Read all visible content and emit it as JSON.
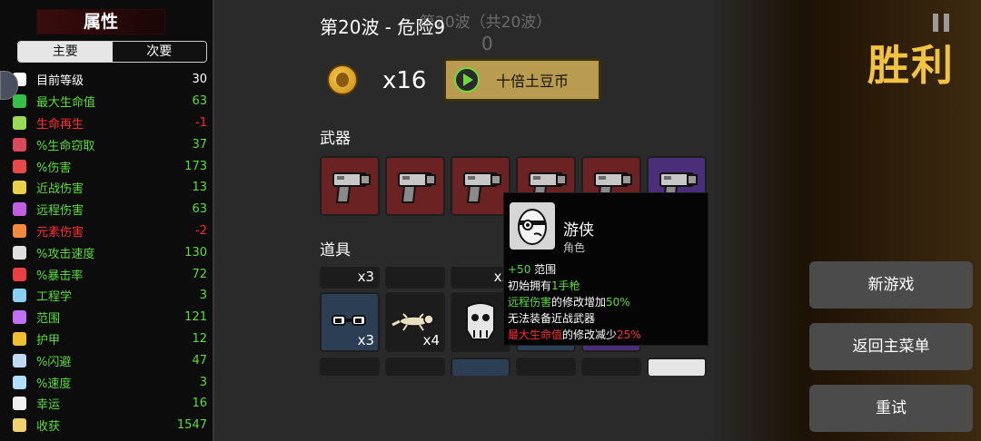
{
  "stats": {
    "title": "属性",
    "tabs": [
      {
        "label": "主要",
        "active": true
      },
      {
        "label": "次要",
        "active": false
      }
    ],
    "items": [
      {
        "label": "目前等级",
        "value": "30",
        "color": "white",
        "icon": "level-icon",
        "icon_color": "#ffffff"
      },
      {
        "label": "最大生命值",
        "value": "63",
        "color": "green",
        "icon": "heart-icon",
        "icon_color": "#36c04a"
      },
      {
        "label": "生命再生",
        "value": "-1",
        "color": "red",
        "icon": "regen-icon",
        "icon_color": "#9ad85a"
      },
      {
        "label": "%生命窃取",
        "value": "37",
        "color": "green",
        "icon": "lifesteal-icon",
        "icon_color": "#d84a5a"
      },
      {
        "label": "%伤害",
        "value": "173",
        "color": "green",
        "icon": "damage-icon",
        "icon_color": "#e84a4a"
      },
      {
        "label": "近战伤害",
        "value": "13",
        "color": "green",
        "icon": "melee-icon",
        "icon_color": "#e8d04a"
      },
      {
        "label": "远程伤害",
        "value": "63",
        "color": "green",
        "icon": "ranged-icon",
        "icon_color": "#c060e0"
      },
      {
        "label": "元素伤害",
        "value": "-2",
        "color": "red",
        "icon": "elemental-icon",
        "icon_color": "#f08a40"
      },
      {
        "label": "%攻击速度",
        "value": "130",
        "color": "green",
        "icon": "attack-speed-icon",
        "icon_color": "#e0e0e0"
      },
      {
        "label": "%暴击率",
        "value": "72",
        "color": "green",
        "icon": "crit-icon",
        "icon_color": "#e84040"
      },
      {
        "label": "工程学",
        "value": "3",
        "color": "green",
        "icon": "engineering-icon",
        "icon_color": "#8ad0f0"
      },
      {
        "label": "范围",
        "value": "121",
        "color": "green",
        "icon": "range-icon",
        "icon_color": "#c070f0"
      },
      {
        "label": "护甲",
        "value": "12",
        "color": "green",
        "icon": "armor-icon",
        "icon_color": "#f0c030"
      },
      {
        "label": "%闪避",
        "value": "47",
        "color": "green",
        "icon": "dodge-icon",
        "icon_color": "#c0d8f0"
      },
      {
        "label": "%速度",
        "value": "3",
        "color": "green",
        "icon": "speed-icon",
        "icon_color": "#b0e0ff"
      },
      {
        "label": "幸运",
        "value": "16",
        "color": "green",
        "icon": "luck-icon",
        "icon_color": "#f0f0f0"
      },
      {
        "label": "收获",
        "value": "1547",
        "color": "green",
        "icon": "harvest-icon",
        "icon_color": "#f0d070"
      }
    ]
  },
  "wave": {
    "title": "第20波 - 危险9",
    "ghost_text": "第20波（共20波）",
    "ghost_zero": "0"
  },
  "currency": {
    "count": "x16",
    "button_label": "十倍土豆币"
  },
  "sections": {
    "weapons": "武器",
    "items": "道具"
  },
  "weapons": [
    {
      "name": "pistol",
      "tier": "red"
    },
    {
      "name": "pistol",
      "tier": "red"
    },
    {
      "name": "pistol",
      "tier": "red"
    },
    {
      "name": "pistol",
      "tier": "red"
    },
    {
      "name": "pistol",
      "tier": "red"
    },
    {
      "name": "pistol",
      "tier": "purple"
    }
  ],
  "items_grid": {
    "row_top_qty": [
      "x3",
      "x3"
    ],
    "row_mid": [
      {
        "name": "glasses-item",
        "qty": "x3"
      },
      {
        "name": "lizard-item",
        "qty": "x4"
      },
      {
        "name": "skull-item",
        "qty": ""
      }
    ]
  },
  "tooltip": {
    "name": "游侠",
    "type": "角色",
    "lines": [
      [
        {
          "t": "+50",
          "c": "green"
        },
        {
          "t": " 范围",
          "c": "white"
        }
      ],
      [
        {
          "t": "初始拥有",
          "c": "white"
        },
        {
          "t": "1手枪",
          "c": "green"
        }
      ],
      [
        {
          "t": "远程伤害",
          "c": "green"
        },
        {
          "t": "的修改增加",
          "c": "white"
        },
        {
          "t": "50%",
          "c": "green"
        }
      ],
      [
        {
          "t": "无法装备近战武器",
          "c": "white"
        }
      ],
      [
        {
          "t": "最大生命值",
          "c": "red"
        },
        {
          "t": "的修改减少",
          "c": "white"
        },
        {
          "t": "25%",
          "c": "red"
        }
      ]
    ]
  },
  "result": {
    "title": "胜利"
  },
  "buttons": {
    "new_game": "新游戏",
    "main_menu": "返回主菜单",
    "retry": "重试"
  }
}
